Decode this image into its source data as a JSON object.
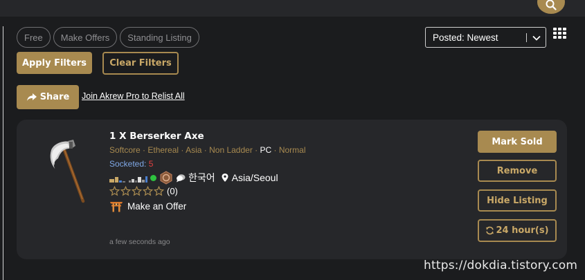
{
  "filters": {
    "chips": [
      "Free",
      "Make Offers",
      "Standing Listing"
    ],
    "sort_value": "Posted: Newest",
    "apply_label": "Apply Filters",
    "clear_label": "Clear Filters"
  },
  "actions": {
    "share_label": "Share",
    "relist_label": "Join Akrew Pro to Relist All"
  },
  "listing": {
    "title": "1 X Berserker Axe",
    "attributes": {
      "mode": "Softcore",
      "realm": "Ethereal",
      "region": "Asia",
      "ladder": "Non Ladder",
      "platform": "PC",
      "difficulty": "Normal",
      "separator": " · "
    },
    "sockets_label": "Socketed:",
    "sockets_value": "5",
    "seller": {
      "language": "한국어",
      "location": "Asia/Seoul",
      "online_color": "#2ec23f"
    },
    "rating": {
      "stars": 0,
      "max": 5,
      "count_label": "(0)"
    },
    "offer_label": "Make an Offer",
    "posted": "a few seconds ago",
    "buttons": {
      "mark_sold": "Mark Sold",
      "remove": "Remove",
      "hide": "Hide Listing",
      "renew": "24 hour(s)"
    }
  },
  "icons": {
    "search": "search-icon",
    "grid": "grid-view-icon",
    "share": "share-icon",
    "chat": "chat-icon",
    "location": "location-pin-icon",
    "refresh": "refresh-icon",
    "torii": "torii-gate-icon"
  },
  "colors": {
    "accent": "#a88a50",
    "background": "#1b1c1e",
    "card": "#26272a",
    "socket_label": "#7fa8e6",
    "socket_value": "#e04040"
  },
  "watermark": "https://dokdia.tistory.com"
}
